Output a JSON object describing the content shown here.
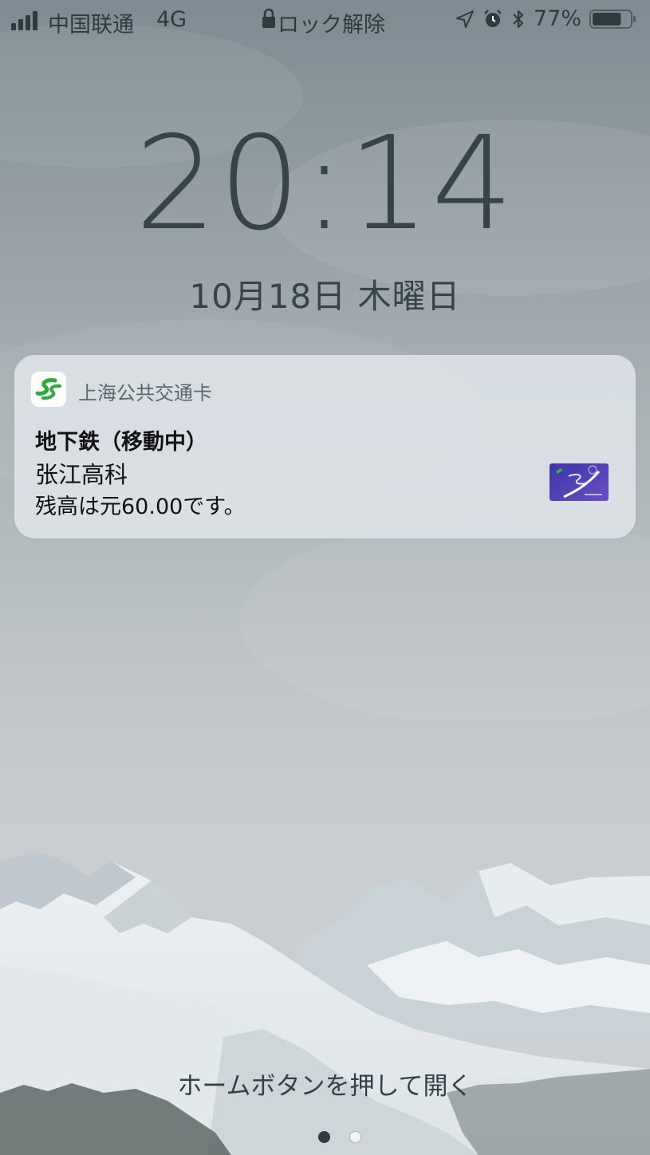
{
  "status_bar": {
    "carrier": "中国联通",
    "network": "4G",
    "lock_label": "ロック解除",
    "battery_percent": "77%",
    "battery_level": 0.77,
    "icons": [
      "signal-icon",
      "lock-icon",
      "location-icon",
      "alarm-icon",
      "bluetooth-icon",
      "battery-icon"
    ]
  },
  "lock_screen": {
    "time": "20:14",
    "date": "10月18日 木曜日"
  },
  "notification": {
    "app_name": "上海公共交通卡",
    "title": "地下鉄（移動中）",
    "line1": "张江高科",
    "line2": "残高は元60.00です。"
  },
  "bottom": {
    "unlock_hint": "ホームボタンを押して開く",
    "page_count": 1
  },
  "colors": {
    "text_dark": "#37434a",
    "notification_bg": "#dee4e8",
    "app_icon_green": "#2eaa3c",
    "card_purple": "#4a3fb0"
  }
}
